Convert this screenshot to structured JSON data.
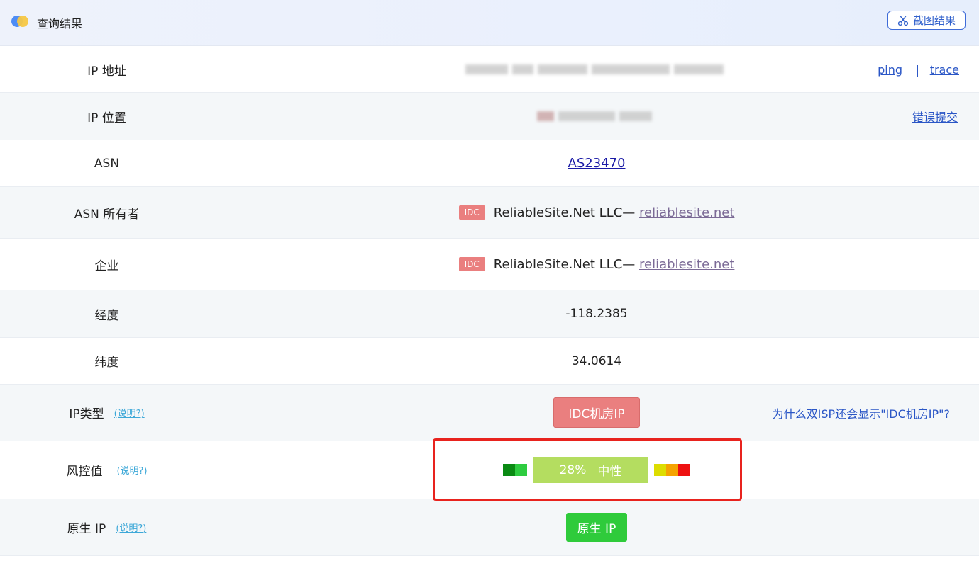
{
  "header": {
    "title": "查询结果",
    "screenshot_button": "截图结果"
  },
  "rows": {
    "ip_address": {
      "label": "IP 地址",
      "link_ping": "ping",
      "link_sep": "|",
      "link_trace": "trace"
    },
    "ip_location": {
      "label": "IP 位置",
      "report_link": "错误提交"
    },
    "asn": {
      "label": "ASN",
      "value": "AS23470"
    },
    "asn_owner": {
      "label": "ASN 所有者",
      "badge": "IDC",
      "name": "ReliableSite.Net LLC— ",
      "domain": "reliablesite.net"
    },
    "company": {
      "label": "企业",
      "badge": "IDC",
      "name": "ReliableSite.Net LLC— ",
      "domain": "reliablesite.net"
    },
    "longitude": {
      "label": "经度",
      "value": "-118.2385"
    },
    "latitude": {
      "label": "纬度",
      "value": "34.0614"
    },
    "ip_type": {
      "label": "IP类型",
      "help": "(说明?)",
      "value": "IDC机房IP",
      "faq_link": "为什么双ISP还会显示\"IDC机房IP\"?"
    },
    "risk": {
      "label": "风控值",
      "help": "(说明?)",
      "percent": "28%",
      "level": "中性",
      "colors": [
        "#0a8a13",
        "#2ecc40",
        "#b4dd60",
        "#dddd00",
        "#f5a300",
        "#ee1111"
      ]
    },
    "native_ip": {
      "label": "原生 IP",
      "help": "(说明?)",
      "value": "原生 IP"
    }
  }
}
